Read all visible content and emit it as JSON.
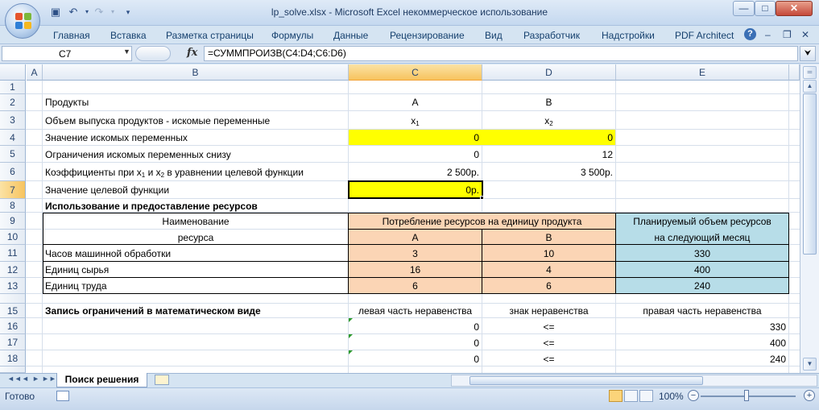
{
  "window": {
    "title": "lp_solve.xlsx - Microsoft Excel некоммерческое использование",
    "min_symbol": "—",
    "max_symbol": "□",
    "close_symbol": "✕"
  },
  "ribbon_tabs": [
    "Главная",
    "Вставка",
    "Разметка страницы",
    "Формулы",
    "Данные",
    "Рецензирование",
    "Вид",
    "Разработчик",
    "Надстройки",
    "PDF Architect"
  ],
  "ribbon_extra": {
    "help": "?",
    "min": "–",
    "restore": "❐",
    "close": "✕"
  },
  "formula_bar": {
    "name_box": "C7",
    "fx": "fx",
    "formula": "=СУММПРОИЗВ(C4:D4;C6:D6)"
  },
  "columns": [
    "A",
    "B",
    "C",
    "D",
    "E"
  ],
  "rows": [
    "1",
    "2",
    "3",
    "4",
    "5",
    "6",
    "7",
    "8",
    "9",
    "10",
    "11",
    "12",
    "13",
    "15",
    "16",
    "17",
    "18"
  ],
  "cells": {
    "b2": "Продукты",
    "c2": "A",
    "d2": "B",
    "b3": "Объем выпуска продуктов - искомые переменные",
    "c3_x": "x",
    "c3_sub": "1",
    "d3_x": "x",
    "d3_sub": "2",
    "b4": "Значение искомых переменных",
    "c4": "0",
    "d4": "0",
    "b5": "Ограничения искомых переменных снизу",
    "c5": "0",
    "d5": "12",
    "b6_part1": "Коэффициенты при x",
    "b6_sub1": "1",
    "b6_part2": " и x",
    "b6_sub2": "2",
    "b6_part3": " в уравнении целевой функции",
    "c6": "2 500р.",
    "d6": "3 500р.",
    "b7": "Значение целевой функции",
    "c7": "0р.",
    "b8": "Использование и предоставление ресурсов",
    "b9": "Наименование",
    "b10": "ресурса",
    "cd9": "Потребление ресурсов на единицу продукта",
    "c10": "A",
    "d10": "B",
    "e9": "Планируемый объем ресурсов",
    "e10": "на следующий месяц",
    "b11": "Часов машинной обработки",
    "c11": "3",
    "d11": "10",
    "e11": "330",
    "b12": "Единиц сырья",
    "c12": "16",
    "d12": "4",
    "e12": "400",
    "b13": "Единиц труда",
    "c13": "6",
    "d13": "6",
    "e13": "240",
    "b15": "Запись ограничений в математическом виде",
    "c15": "левая часть неравенства",
    "d15": "знак неравенства",
    "e15": "правая часть неравенства",
    "c16": "0",
    "d16": "<=",
    "e16": "330",
    "c17": "0",
    "d17": "<=",
    "e17": "400",
    "c18": "0",
    "d18": "<=",
    "e18": "240"
  },
  "sheet_tab": "Поиск решения",
  "nav_arrows": [
    "◄◄",
    "◄",
    "►",
    "►►"
  ],
  "status": {
    "ready": "Готово",
    "zoom": "100%",
    "zoom_minus": "−",
    "zoom_plus": "+"
  },
  "colors": {
    "yellow": "#ffff00",
    "peach": "#fbd5b5",
    "teal": "#b7dde8",
    "selection": "#f7c35e"
  }
}
